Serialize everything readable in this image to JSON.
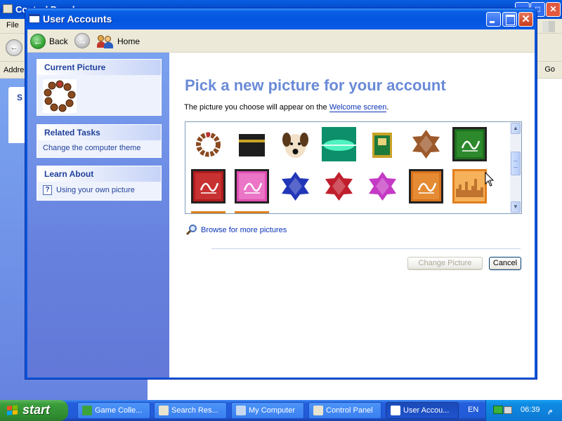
{
  "background_window": {
    "title": "Control Panel",
    "menu_first": "File",
    "address_label": "Address",
    "go_label": "Go",
    "side_panel_letter": "S"
  },
  "window": {
    "title": "User Accounts",
    "nav": {
      "back_label": "Back",
      "home_label": "Home"
    },
    "tasks": {
      "current_picture_header": "Current Picture",
      "related_tasks_header": "Related Tasks",
      "related_tasks_link": "Change the computer theme",
      "learn_about_header": "Learn About",
      "learn_about_link": "Using your own picture"
    },
    "main": {
      "heading": "Pick a new picture for your account",
      "desc_before": "The picture you choose will appear on the ",
      "desc_link": "Welcome screen",
      "desc_after": ".",
      "browse_label": "Browse for more pictures",
      "change_button": "Change Picture",
      "cancel_button": "Cancel"
    },
    "gallery": [
      {
        "name": "prayer-beads",
        "colors": [
          "#ffffff",
          "#8a4a20"
        ]
      },
      {
        "name": "kaaba",
        "colors": [
          "#ffffff",
          "#1e1e1e"
        ]
      },
      {
        "name": "dog",
        "colors": [
          "#ffffff",
          "#f2e0c8"
        ]
      },
      {
        "name": "green-glow",
        "colors": [
          "#0c8f6a",
          "#4ff2c0"
        ]
      },
      {
        "name": "quran-book",
        "colors": [
          "#ffffff",
          "#c9a227"
        ]
      },
      {
        "name": "brown-star",
        "colors": [
          "#ffffff",
          "#9c5a2c"
        ]
      },
      {
        "name": "green-calligraphy",
        "colors": [
          "#1e6e1e",
          "#3aa33a"
        ]
      },
      {
        "name": "red-calligraphy",
        "colors": [
          "#b11d1d",
          "#e04545"
        ]
      },
      {
        "name": "pink-calligraphy",
        "colors": [
          "#e04fb3",
          "#f59bd9"
        ]
      },
      {
        "name": "blue-star",
        "colors": [
          "#ffffff",
          "#2236b8"
        ]
      },
      {
        "name": "red-star",
        "colors": [
          "#ffffff",
          "#c01e2c"
        ]
      },
      {
        "name": "magenta-star",
        "colors": [
          "#ffffff",
          "#c43ac4"
        ]
      },
      {
        "name": "orange-calligraphy",
        "colors": [
          "#d8741c",
          "#f2a24a"
        ]
      },
      {
        "name": "orange-skyline",
        "colors": [
          "#e07e1e",
          "#f5b25a"
        ]
      }
    ]
  },
  "taskbar": {
    "start_label": "start",
    "items": [
      {
        "label": "Game Colle...",
        "icon": "game-icon",
        "color": "#3ca33c"
      },
      {
        "label": "Search Res...",
        "icon": "search-icon",
        "color": "#e8e4cf"
      },
      {
        "label": "My Computer",
        "icon": "computer-icon",
        "color": "#c8d8f0"
      },
      {
        "label": "Control Panel",
        "icon": "control-panel-icon",
        "color": "#e8e4cf"
      },
      {
        "label": "User Accou...",
        "icon": "window-icon",
        "color": "#ffffff"
      }
    ],
    "language": "EN",
    "clock": "06:39",
    "ampm": "م"
  }
}
